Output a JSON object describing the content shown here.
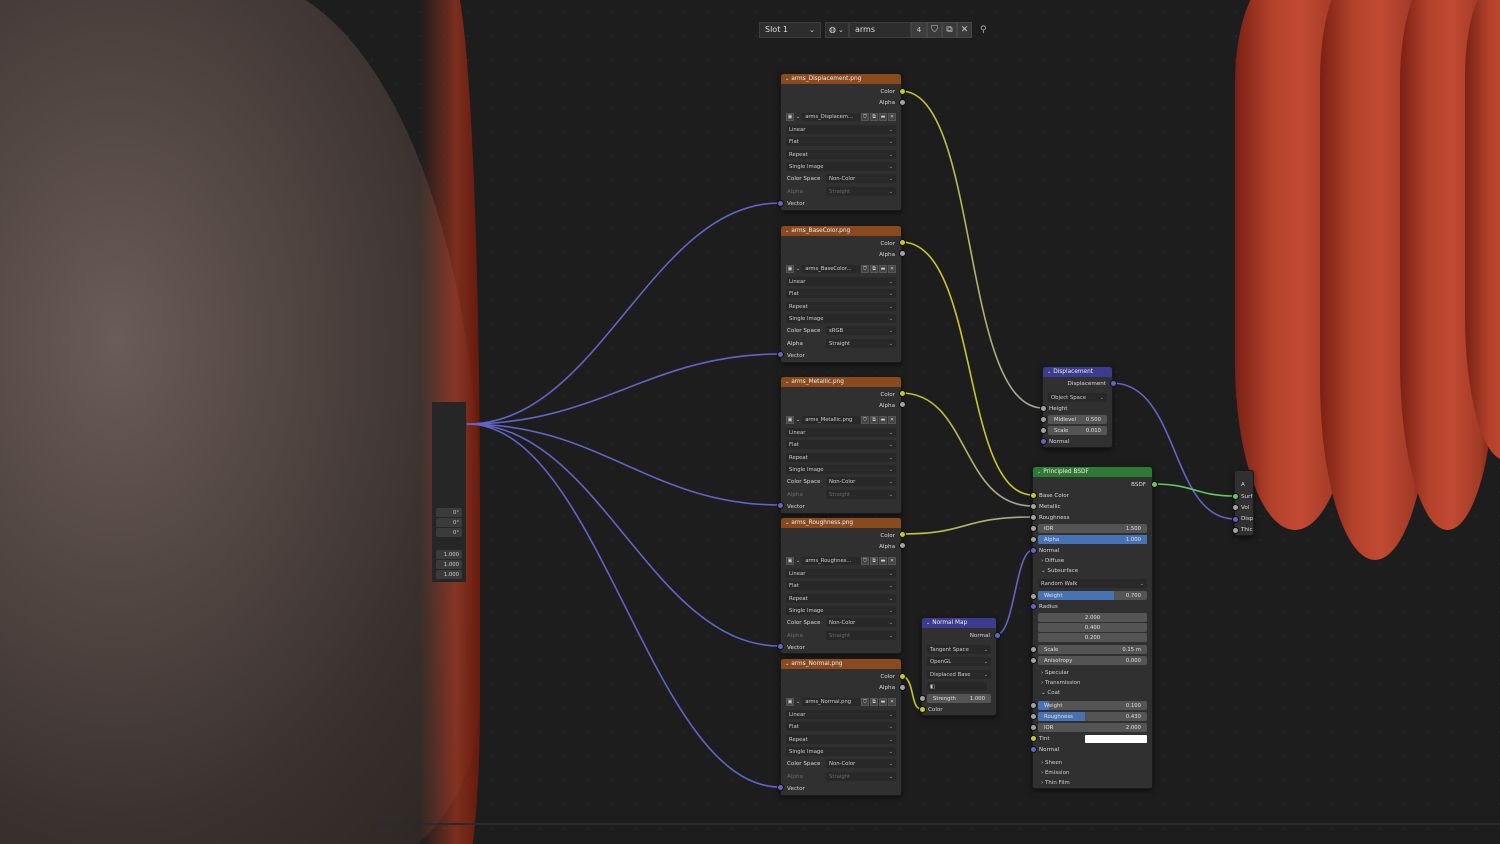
{
  "header": {
    "slot": "Slot 1",
    "material": "arms",
    "users": "4"
  },
  "tex_nodes": [
    {
      "title": "arms_Displacement.png",
      "image": "arms_Displacem...",
      "interp": "Linear",
      "proj": "Flat",
      "ext": "Repeat",
      "src": "Single Image",
      "colorspace_label": "Color Space",
      "colorspace": "Non-Color",
      "alpha_label": "Alpha",
      "alpha": "Straight",
      "alpha_dim": true
    },
    {
      "title": "arms_BaseColor.png",
      "image": "arms_BaseColor...",
      "interp": "Linear",
      "proj": "Flat",
      "ext": "Repeat",
      "src": "Single Image",
      "colorspace_label": "Color Space",
      "colorspace": "sRGB",
      "alpha_label": "Alpha",
      "alpha": "Straight",
      "alpha_dim": false
    },
    {
      "title": "arms_Metallic.png",
      "image": "arms_Metallic.png",
      "interp": "Linear",
      "proj": "Flat",
      "ext": "Repeat",
      "src": "Single Image",
      "colorspace_label": "Color Space",
      "colorspace": "Non-Color",
      "alpha_label": "Alpha",
      "alpha": "Straight",
      "alpha_dim": true
    },
    {
      "title": "arms_Roughness.png",
      "image": "arms_Roughnes...",
      "interp": "Linear",
      "proj": "Flat",
      "ext": "Repeat",
      "src": "Single Image",
      "colorspace_label": "Color Space",
      "colorspace": "Non-Color",
      "alpha_label": "Alpha",
      "alpha": "Straight",
      "alpha_dim": true
    },
    {
      "title": "arms_Normal.png",
      "image": "arms_Normal.png",
      "interp": "Linear",
      "proj": "Flat",
      "ext": "Repeat",
      "src": "Single Image",
      "colorspace_label": "Color Space",
      "colorspace": "Non-Color",
      "alpha_label": "Alpha",
      "alpha": "Straight",
      "alpha_dim": true
    }
  ],
  "socket_labels": {
    "color": "Color",
    "alpha": "Alpha",
    "vector": "Vector"
  },
  "displacement": {
    "title": "Displacement",
    "out": "Displacement",
    "space": "Object Space",
    "height": "Height",
    "midlevel_label": "Midlevel",
    "midlevel": "0.500",
    "scale_label": "Scale",
    "scale": "0.010",
    "normal": "Normal"
  },
  "normal_map": {
    "title": "Normal Map",
    "out": "Normal",
    "space": "Tangent Space",
    "convention": "OpenGL",
    "base": "Displaced Base",
    "strength_label": "Strength",
    "strength": "1.000",
    "color": "Color"
  },
  "bsdf": {
    "title": "Principled BSDF",
    "out": "BSDF",
    "base_color": "Base Color",
    "metallic": "Metallic",
    "roughness": "Roughness",
    "ior_label": "IOR",
    "ior": "1.500",
    "alpha_label": "Alpha",
    "alpha": "1.000",
    "alpha_fill": 1.0,
    "normal": "Normal",
    "diffuse": "Diffuse",
    "subsurface": "Subsurface",
    "method": "Random Walk",
    "weight_label": "Weight",
    "weight": "0.700",
    "weight_fill": 0.7,
    "radius_label": "Radius",
    "radius": [
      "2.000",
      "0.400",
      "0.200"
    ],
    "scale_label": "Scale",
    "scale": "0.15 m",
    "aniso_label": "Anisotropy",
    "aniso": "0.000",
    "specular": "Specular",
    "transmission": "Transmission",
    "coat": "Coat",
    "coat_weight_label": "Weight",
    "coat_weight": "0.100",
    "coat_weight_fill": 0.1,
    "coat_rough_label": "Roughness",
    "coat_rough": "0.430",
    "coat_rough_fill": 0.43,
    "coat_ior_label": "IOR",
    "coat_ior": "2.000",
    "tint": "Tint",
    "coat_normal": "Normal",
    "sheen": "Sheen",
    "emission": "Emission",
    "thin_film": "Thin Film"
  },
  "output_partial": [
    "A",
    "Surf",
    "Vol",
    "Disp",
    "Thic"
  ],
  "left_panel": {
    "angles": [
      "0°",
      "0°",
      "0°"
    ],
    "scales": [
      "1.000",
      "1.000",
      "1.000"
    ]
  },
  "colors": {
    "texture_header": "#8a4a1e",
    "vector_header": "#3b3b8f",
    "shader_header": "#2f7a33",
    "field_fill": "#4772b3",
    "wire_yellow": "#c7c729",
    "wire_purple": "#6363c7",
    "wire_green": "#63c763"
  }
}
